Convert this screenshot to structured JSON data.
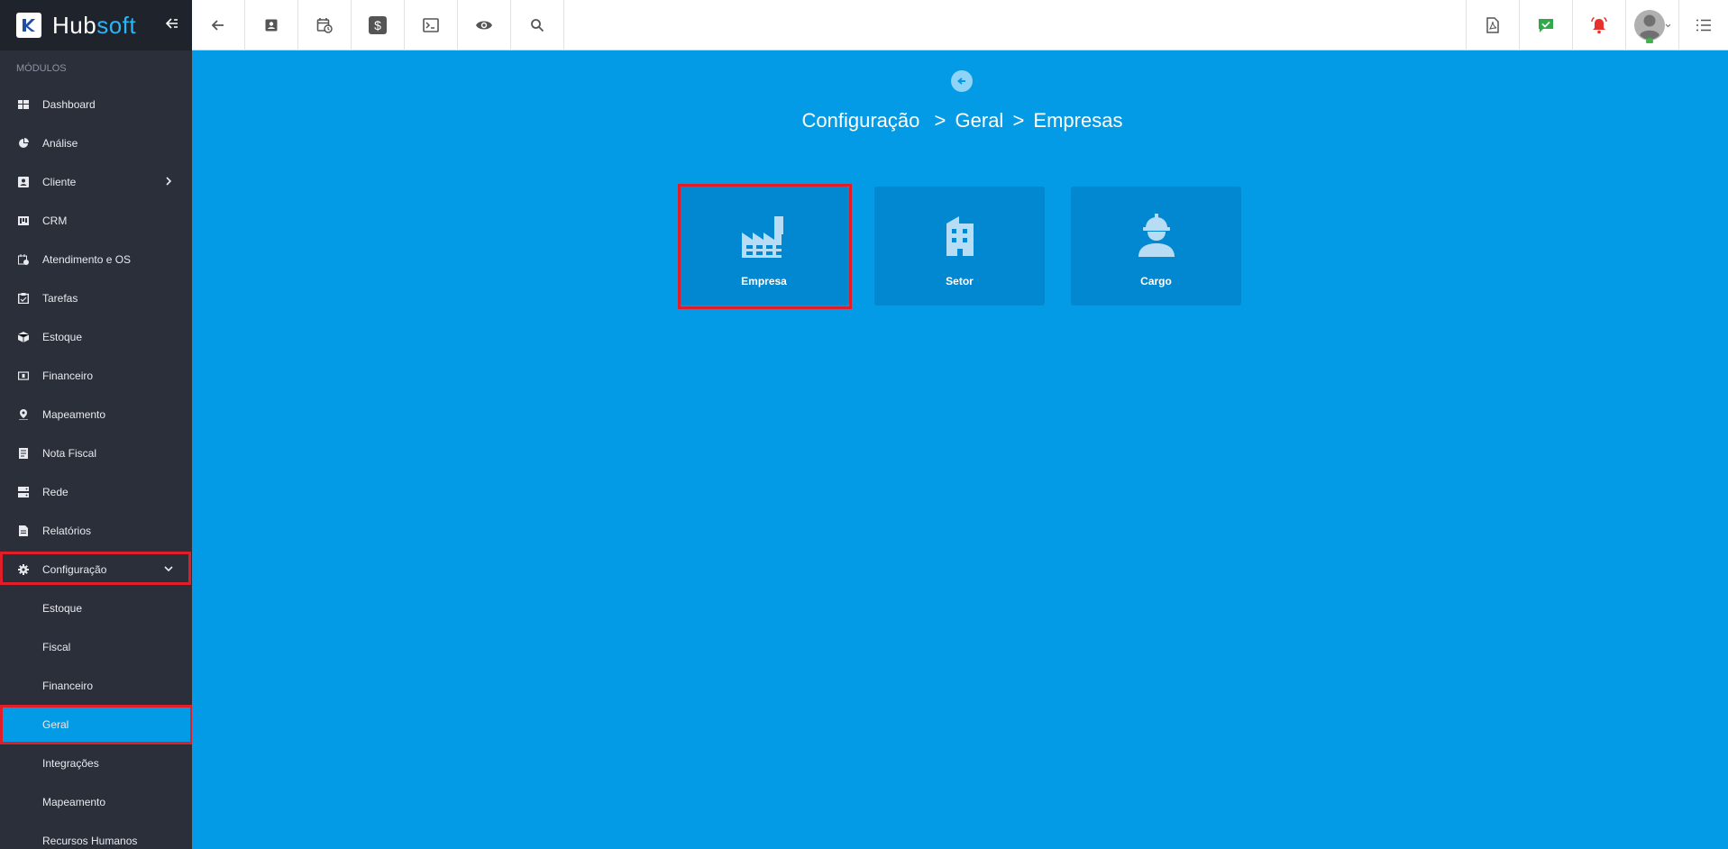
{
  "brand": {
    "name_part1": "Hub",
    "name_part2": "soft"
  },
  "sidebar": {
    "section_label": "MÓDULOS",
    "items": [
      {
        "label": "Dashboard",
        "icon": "dashboard-icon"
      },
      {
        "label": "Análise",
        "icon": "pie-chart-icon"
      },
      {
        "label": "Cliente",
        "icon": "contact-card-icon",
        "has_children": true
      },
      {
        "label": "CRM",
        "icon": "kanban-icon"
      },
      {
        "label": "Atendimento e OS",
        "icon": "calendar-clock-icon"
      },
      {
        "label": "Tarefas",
        "icon": "clipboard-icon"
      },
      {
        "label": "Estoque",
        "icon": "box-icon"
      },
      {
        "label": "Financeiro",
        "icon": "money-icon"
      },
      {
        "label": "Mapeamento",
        "icon": "map-pin-icon"
      },
      {
        "label": "Nota Fiscal",
        "icon": "receipt-icon"
      },
      {
        "label": "Rede",
        "icon": "server-icon"
      },
      {
        "label": "Relatórios",
        "icon": "document-icon"
      },
      {
        "label": "Configuração",
        "icon": "gear-icon",
        "expanded": true
      }
    ],
    "subitems": [
      {
        "label": "Estoque"
      },
      {
        "label": "Fiscal"
      },
      {
        "label": "Financeiro"
      },
      {
        "label": "Geral",
        "active": true
      },
      {
        "label": "Integrações"
      },
      {
        "label": "Mapeamento"
      },
      {
        "label": "Recursos Humanos"
      }
    ]
  },
  "topbar": {
    "left_icons": [
      "back-arrow-icon",
      "contact-card-icon",
      "calendar-clock-icon",
      "dollar-icon",
      "terminal-icon",
      "eye-icon",
      "search-icon"
    ],
    "right_icons": [
      "pdf-icon",
      "chat-check-icon",
      "bell-icon",
      "avatar",
      "list-icon"
    ]
  },
  "main": {
    "breadcrumb": [
      "Configuração",
      "Geral",
      "Empresas"
    ],
    "breadcrumb_sep": ">",
    "cards": [
      {
        "label": "Empresa",
        "icon": "factory-icon",
        "highlighted": true
      },
      {
        "label": "Setor",
        "icon": "building-icon"
      },
      {
        "label": "Cargo",
        "icon": "worker-icon"
      }
    ]
  },
  "colors": {
    "sidebar_bg": "#2b2f3a",
    "content_bg": "#039be5",
    "card_bg": "#0288d1",
    "highlight": "#e01e2a",
    "accent": "#29b6f6"
  }
}
